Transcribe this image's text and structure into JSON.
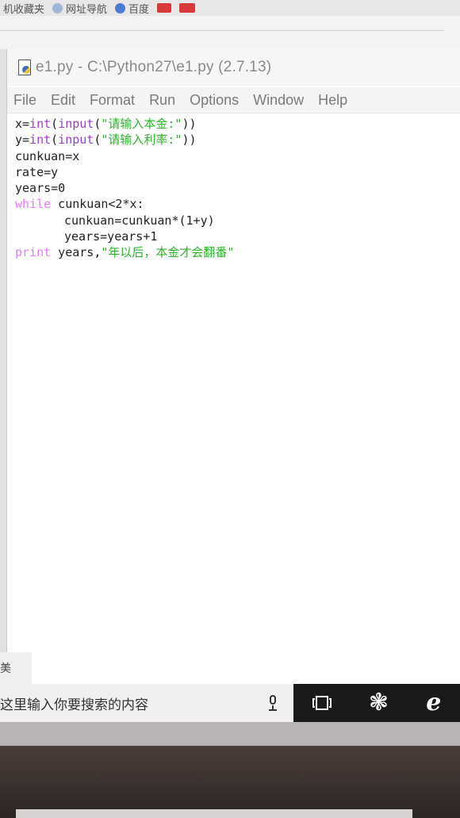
{
  "bookmark_bar": {
    "items": [
      {
        "label": "机收藏夹",
        "icon": "bookmark-icon"
      },
      {
        "label": "网址导航",
        "icon": "globe-icon"
      },
      {
        "label": "百度",
        "icon": "baidu-paw-icon"
      },
      {
        "label": "",
        "icon": "red-app-icon"
      },
      {
        "label": "",
        "icon": "red-app-icon-2"
      }
    ]
  },
  "window": {
    "title": "e1.py - C:\\Python27\\e1.py (2.7.13)"
  },
  "menu": {
    "items": [
      "File",
      "Edit",
      "Format",
      "Run",
      "Options",
      "Window",
      "Help"
    ]
  },
  "code": {
    "line1": {
      "a": "x=",
      "b": "int",
      "c": "(",
      "d": "input",
      "e": "(",
      "f": "\"请输入本金:\"",
      "g": "))"
    },
    "line2": {
      "a": "y=",
      "b": "int",
      "c": "(",
      "d": "input",
      "e": "(",
      "f": "\"请输入利率:\"",
      "g": "))"
    },
    "line3": "cunkuan=x",
    "line4": "rate=y",
    "line5": "years=0",
    "line6": {
      "kw": "while",
      "rest": " cunkuan<2*x:"
    },
    "line7": "cunkuan=cunkuan*(1+y)",
    "line8": "years=years+1",
    "line9": {
      "kw": "print",
      "rest": " years,",
      "str": "\"年以后，本金才会翻番\""
    }
  },
  "taskbar": {
    "stub_label": "美",
    "search_placeholder": "这里输入你要搜索的内容",
    "fan_glyph": "❃",
    "ie_glyph": "e"
  }
}
